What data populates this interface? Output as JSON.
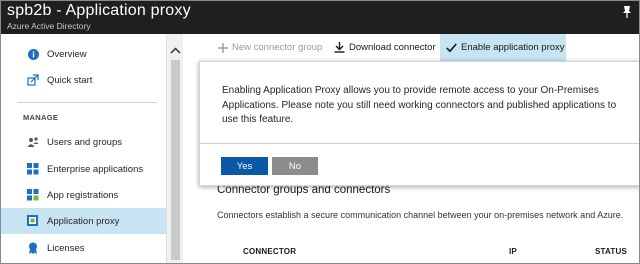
{
  "window": {
    "title": "spb2b - Application proxy",
    "subtitle": "Azure Active Directory"
  },
  "sidebar": {
    "section_label": "MANAGE",
    "items": [
      {
        "label": "Overview",
        "icon": "info-icon"
      },
      {
        "label": "Quick start",
        "icon": "quick-start-icon"
      },
      {
        "label": "Users and groups",
        "icon": "users-icon"
      },
      {
        "label": "Enterprise applications",
        "icon": "enterprise-apps-icon"
      },
      {
        "label": "App registrations",
        "icon": "app-registrations-icon"
      },
      {
        "label": "Application proxy",
        "icon": "app-proxy-icon",
        "selected": true
      },
      {
        "label": "Licenses",
        "icon": "licenses-icon"
      }
    ]
  },
  "toolbar": {
    "new_group_label": "New connector group",
    "download_label": "Download connector",
    "enable_label": "Enable application proxy"
  },
  "main": {
    "section_title": "Connector groups and connectors",
    "section_desc": "Connectors establish a secure communication channel between your on-premises network and Azure.",
    "columns": [
      "CONNECTOR",
      "IP",
      "STATUS"
    ]
  },
  "dialog": {
    "message": "Enabling Application Proxy allows you to provide remote access to your On-Premises Applications. Please note you still need working connectors and published applications to use this feature.",
    "yes_label": "Yes",
    "no_label": "No"
  },
  "colors": {
    "title_bar": "#1f1f1f",
    "selected_bg": "#c7e4f3",
    "primary_button": "#0a58a8",
    "secondary_button": "#8c8c8c"
  }
}
